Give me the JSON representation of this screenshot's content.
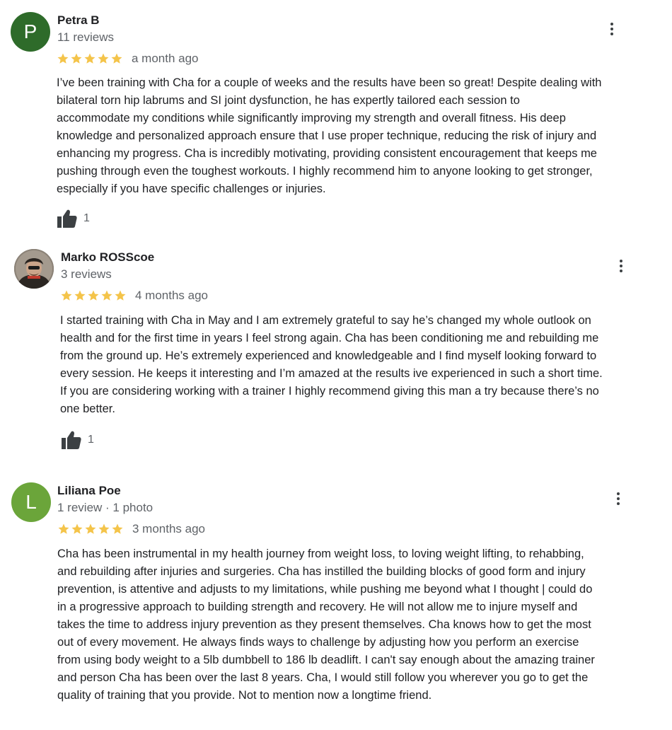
{
  "colors": {
    "star": "#F4C44A",
    "avatar_petra": "#2E6B2A",
    "avatar_liliana": "#6BA53A",
    "text": "#202124",
    "meta": "#5f6368"
  },
  "icons": {
    "more": "more-vert-icon",
    "like": "thumb-up-icon",
    "star": "star-icon"
  },
  "reviews": [
    {
      "avatar_letter": "P",
      "name": "Petra B",
      "meta": "11 reviews",
      "rating": 5,
      "time": "a month ago",
      "text": "I’ve been training with Cha for a couple of weeks and the results have been so great! Despite dealing with\nbilateral torn hip labrums and SI joint dysfunction, he has expertly tailored each session to\naccommodate my conditions while significantly improving my strength and overall fitness. His deep\nknowledge and personalized approach ensure that I use proper technique, reducing the risk of injury and\nenhancing my progress. Cha is incredibly motivating, providing consistent encouragement that keeps me\npushing through even the toughest workouts. I highly recommend him to anyone looking to get stronger,\nespecially if you have specific challenges or injuries.",
      "likes": "1"
    },
    {
      "avatar_letter": "",
      "name": "Marko ROSScoe",
      "meta": "3 reviews",
      "rating": 5,
      "time": "4 months ago",
      "text": "I started training with Cha in May and I am extremely grateful to say he’s changed my whole outlook on\nhealth and for the first time in years I feel strong again. Cha has been conditioning me and rebuilding me\nfrom the ground up. He’s extremely experienced and knowledgeable and I find myself looking forward to\nevery session. He keeps it interesting and I’m amazed at the results ive experienced in such a short time.\nIf you are considering working with a trainer I highly recommend giving this man a try because there’s no\none better.",
      "likes": "1"
    },
    {
      "avatar_letter": "L",
      "name": "Liliana Poe",
      "meta": "1 review · 1 photo",
      "rating": 5,
      "time": "3 months ago",
      "text": "Cha has been instrumental in my health journey from weight loss, to loving weight lifting, to rehabbing,\nand rebuilding after injuries and surgeries. Cha has instilled the building blocks of good form and injury\nprevention, is attentive and adjusts to my limitations, while pushing me beyond what I thought | could do\nin a progressive approach to building strength and recovery. He will not allow me to injure myself and\ntakes the time to address injury prevention as they present themselves. Cha knows how to get the most\nout of every movement. He always finds ways to challenge by adjusting how you perform an exercise\nfrom using body weight to a 5lb dumbbell to 186 lb deadlift. I can't say enough about the amazing trainer\nand person Cha has been over the last 8 years. Cha, I would still follow you wherever you go to get the\nquality of training that you provide. Not to mention now a longtime friend.",
      "likes": ""
    }
  ]
}
